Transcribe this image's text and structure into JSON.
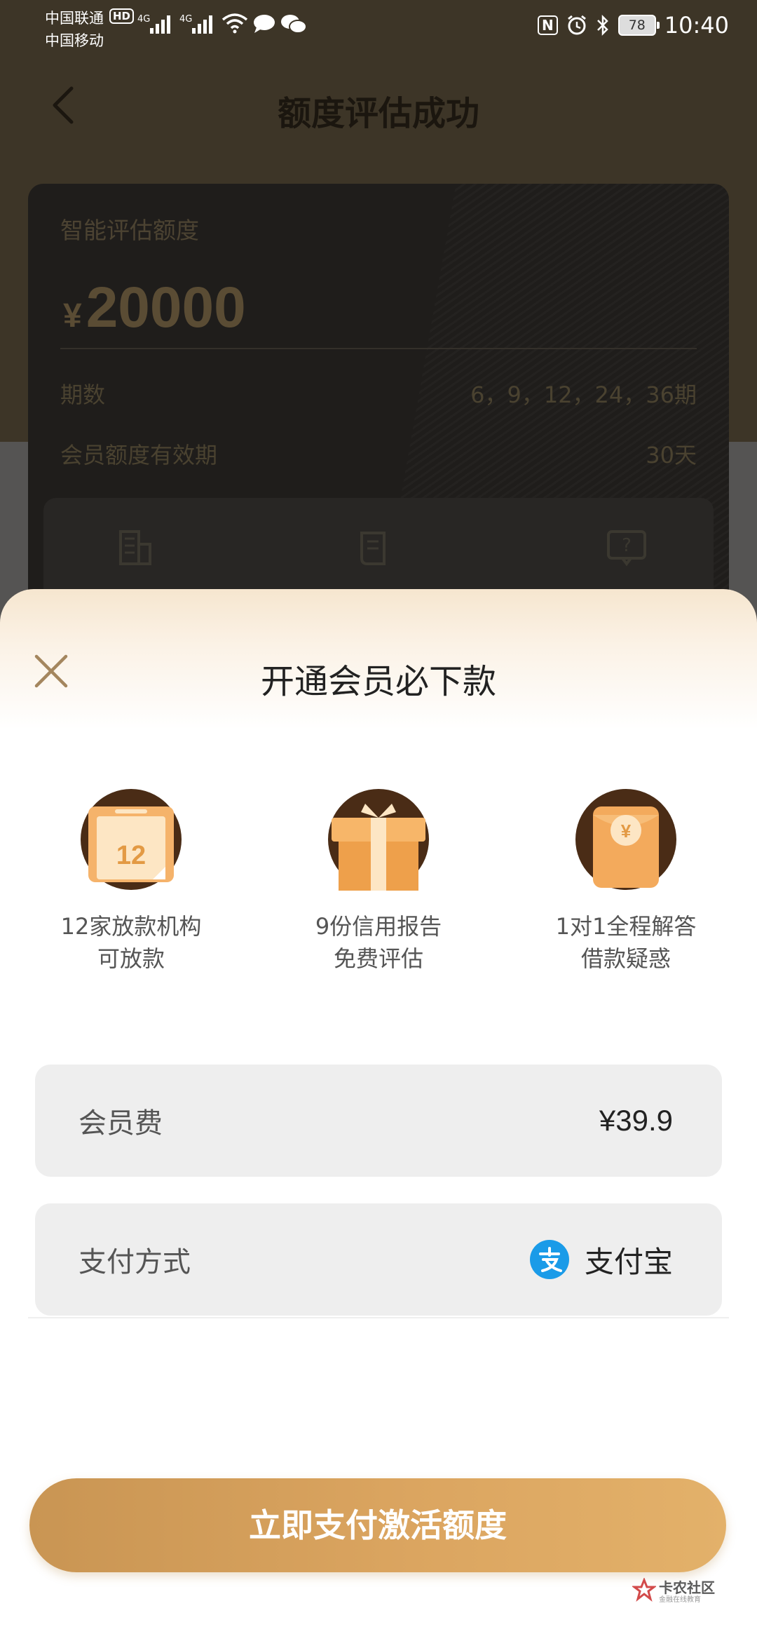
{
  "status_bar": {
    "carrier_1": "中国联通",
    "carrier_1_badge": "HD",
    "carrier_2": "中国移动",
    "network_1": "4G",
    "network_2": "4G",
    "battery": "78",
    "time": "10:40",
    "icons": [
      "signal-icon",
      "wifi-icon",
      "message-icon",
      "wechat-icon",
      "nfc-icon",
      "alarm-icon",
      "bluetooth-icon",
      "battery-icon"
    ]
  },
  "header": {
    "title": "额度评估成功",
    "back_icon": "chevron-left-icon"
  },
  "quota_card": {
    "label": "智能评估额度",
    "currency": "¥",
    "amount": "20000",
    "periods_label": "期数",
    "periods_value": "6，9，12，24，36期",
    "validity_label": "会员额度有效期",
    "validity_value": "30天",
    "feature_icons": [
      "building-icon",
      "scroll-icon",
      "question-chat-icon"
    ]
  },
  "sheet": {
    "close_icon": "close-icon",
    "title": "开通会员必下款",
    "benefits": [
      {
        "icon": "calendar-12-icon",
        "line1": "12家放款机构",
        "line2": "可放款"
      },
      {
        "icon": "gift-icon",
        "line1": "9份信用报告",
        "line2": "免费评估"
      },
      {
        "icon": "red-envelope-yen-icon",
        "line1": "1对1全程解答",
        "line2": "借款疑惑"
      }
    ],
    "fee_label": "会员费",
    "fee_value": "¥39.9",
    "payment_label": "支付方式",
    "payment_value": "支付宝",
    "payment_icon": "alipay-icon",
    "cta_label": "立即支付激活额度"
  },
  "watermark": {
    "text": "卡农社区",
    "sub": "金融在线教育"
  },
  "colors": {
    "accent": "#d9a35e",
    "sheet_top": "#f6e6cf",
    "dim_header": "#3d3527"
  }
}
